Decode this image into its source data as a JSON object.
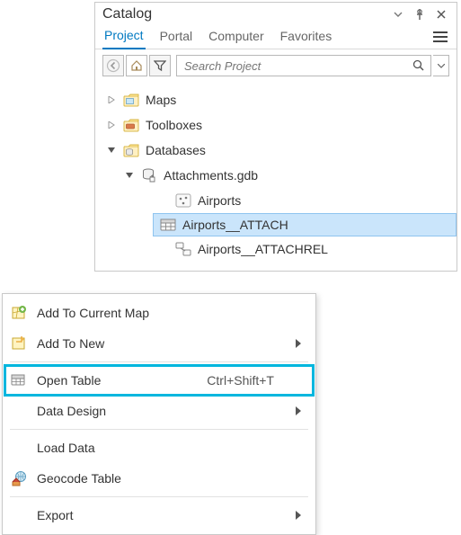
{
  "panel": {
    "title": "Catalog",
    "tabs": [
      "Project",
      "Portal",
      "Computer",
      "Favorites"
    ],
    "active_tab": 0,
    "search_placeholder": "Search Project"
  },
  "tree": {
    "maps": "Maps",
    "toolboxes": "Toolboxes",
    "databases": "Databases",
    "gdb": "Attachments.gdb",
    "fc_airports": "Airports",
    "tbl_attach": "Airports__ATTACH",
    "rel_attachrel": "Airports__ATTACHREL"
  },
  "menu": {
    "add_to_current": "Add To Current Map",
    "add_to_new": "Add To New",
    "open_table": "Open Table",
    "open_table_shortcut": "Ctrl+Shift+T",
    "data_design": "Data Design",
    "load_data": "Load Data",
    "geocode_table": "Geocode Table",
    "export": "Export"
  },
  "colors": {
    "accent": "#0079c1",
    "highlight": "#00b6de",
    "selection": "#cae5fb"
  }
}
